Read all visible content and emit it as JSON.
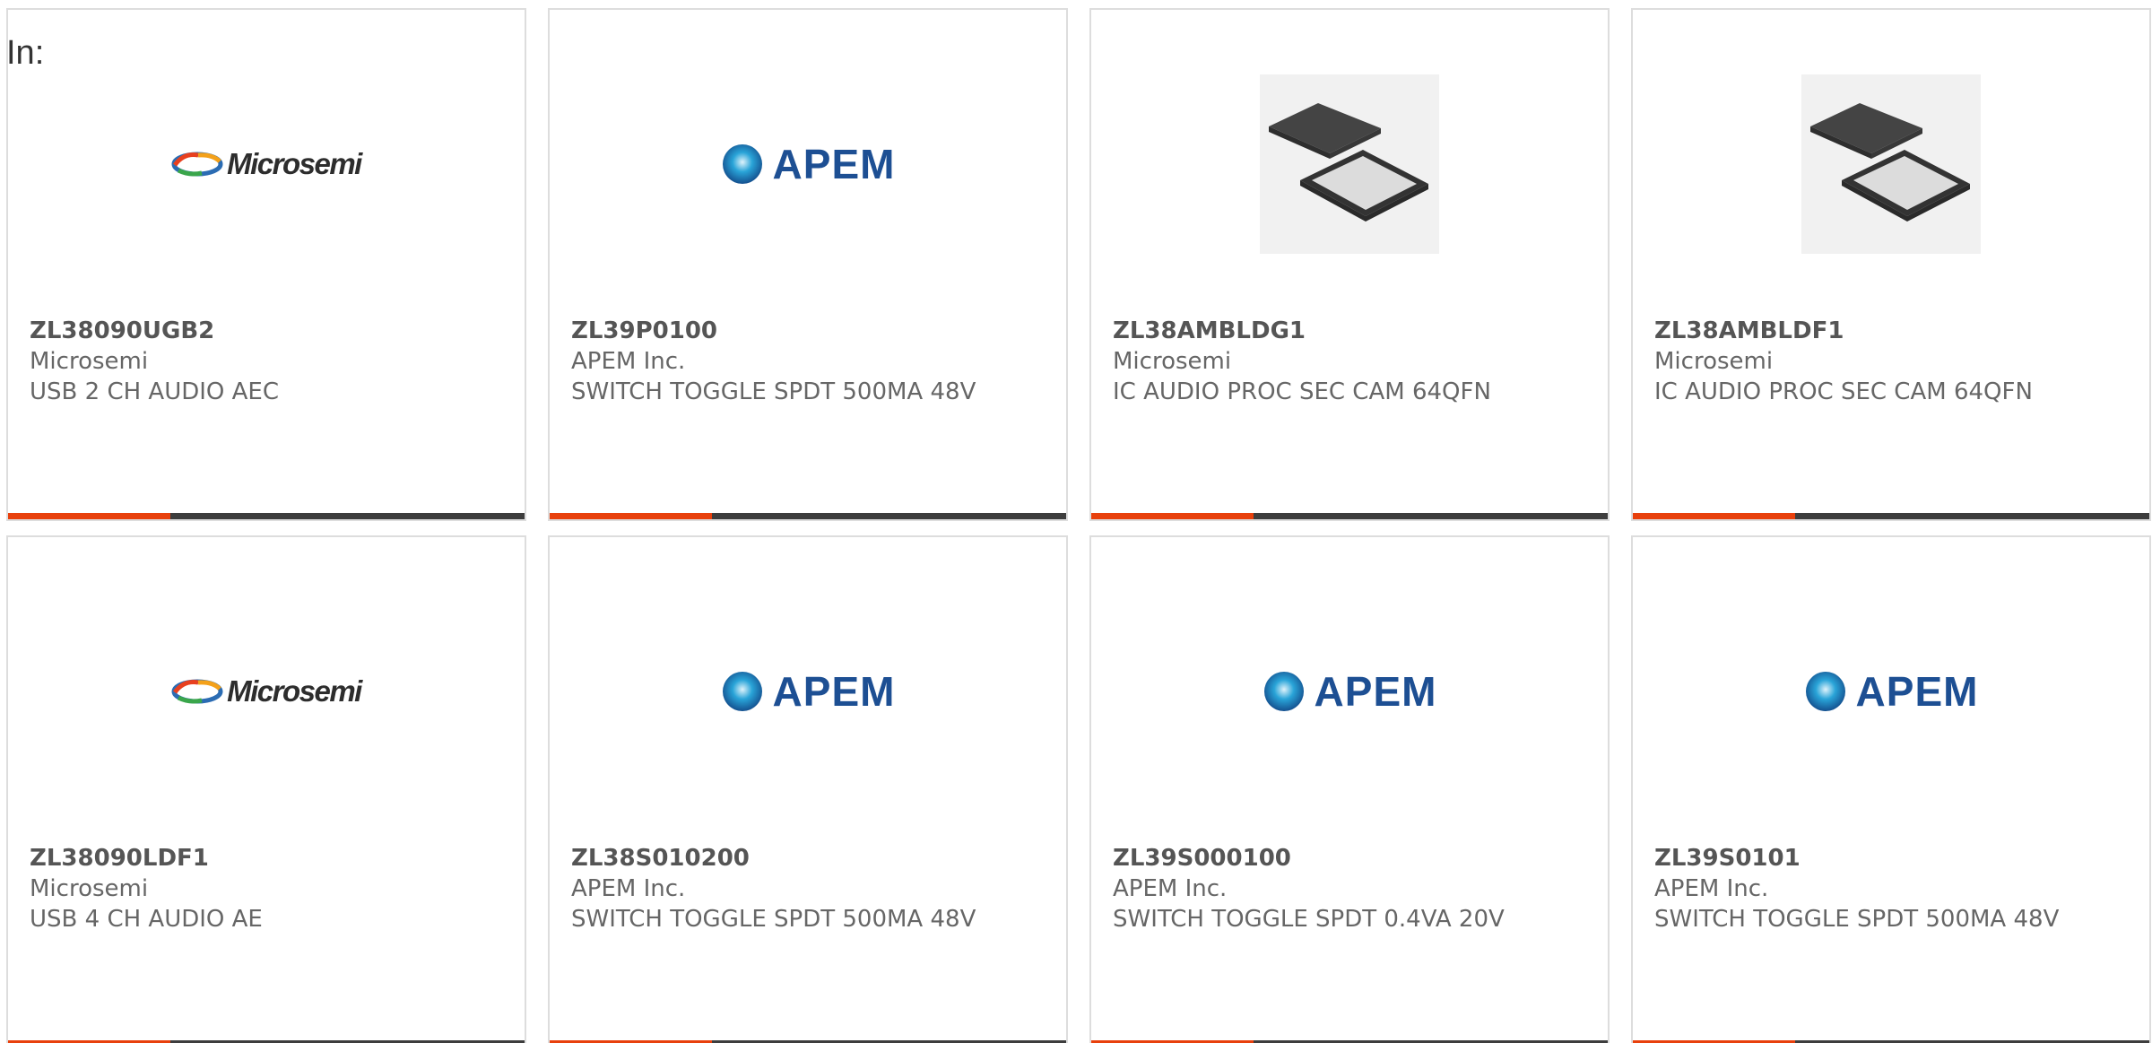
{
  "filter": {
    "label": "In:"
  },
  "products": [
    {
      "part": "ZL38090UGB2",
      "manufacturer": "Microsemi",
      "description": "USB 2 CH AUDIO AEC",
      "image": "microsemi-logo"
    },
    {
      "part": "ZL39P0100",
      "manufacturer": "APEM Inc.",
      "description": "SWITCH TOGGLE SPDT 500MA 48V",
      "image": "apem-logo"
    },
    {
      "part": "ZL38AMBLDG1",
      "manufacturer": "Microsemi",
      "description": "IC AUDIO PROC SEC CAM 64QFN",
      "image": "qfn-chip-photo"
    },
    {
      "part": "ZL38AMBLDF1",
      "manufacturer": "Microsemi",
      "description": "IC AUDIO PROC SEC CAM 64QFN",
      "image": "qfn-chip-photo"
    },
    {
      "part": "ZL38090LDF1",
      "manufacturer": "Microsemi",
      "description": "USB 4 CH AUDIO AE",
      "image": "microsemi-logo"
    },
    {
      "part": "ZL38S010200",
      "manufacturer": "APEM Inc.",
      "description": "SWITCH TOGGLE SPDT 500MA 48V",
      "image": "apem-logo"
    },
    {
      "part": "ZL39S000100",
      "manufacturer": "APEM Inc.",
      "description": "SWITCH TOGGLE SPDT 0.4VA 20V",
      "image": "apem-logo"
    },
    {
      "part": "ZL39S0101",
      "manufacturer": "APEM Inc.",
      "description": "SWITCH TOGGLE SPDT 500MA 48V",
      "image": "apem-logo"
    }
  ],
  "logos": {
    "microsemi_text": "Microsemi",
    "apem_text": "APEM"
  },
  "colors": {
    "accent": "#e8400c",
    "bar": "#3d3d3d",
    "apem_blue": "#1d4f93"
  }
}
